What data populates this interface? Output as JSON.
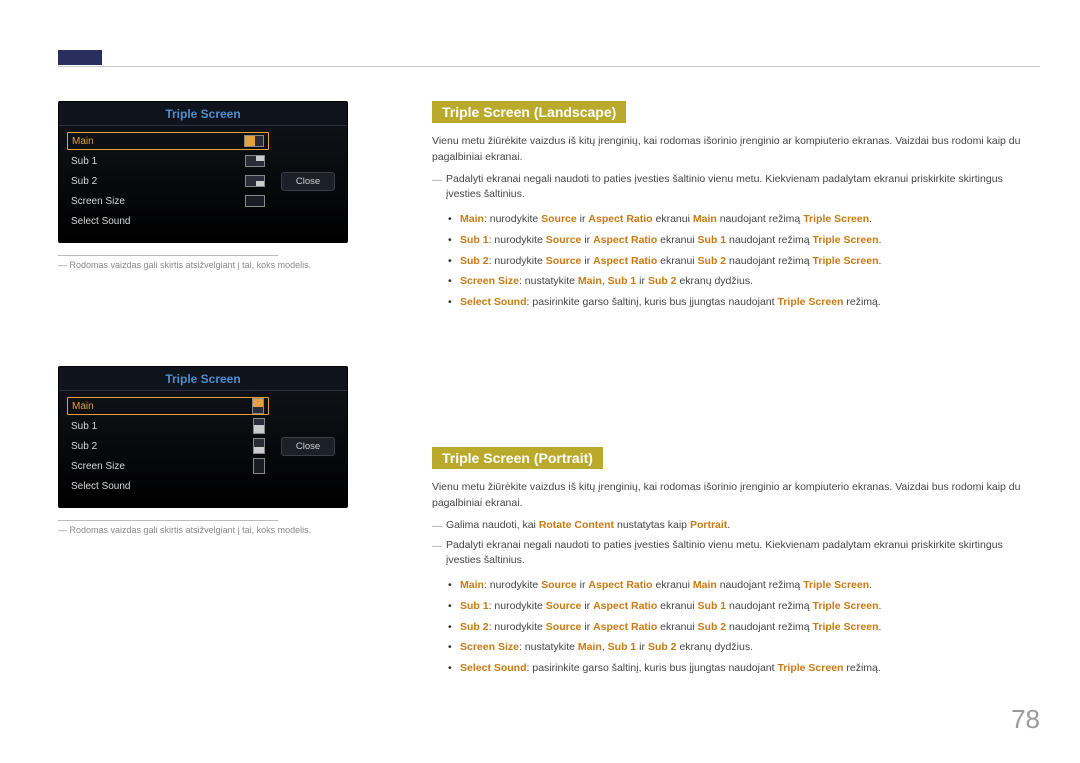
{
  "pageNumber": "78",
  "panels": {
    "landscape": {
      "title": "Triple Screen",
      "rows": [
        {
          "label": "Main",
          "selected": true
        },
        {
          "label": "Sub 1",
          "selected": false
        },
        {
          "label": "Sub 2",
          "selected": false
        },
        {
          "label": "Screen Size",
          "selected": false
        },
        {
          "label": "Select Sound",
          "selected": false
        }
      ],
      "close": "Close",
      "footnote": "Rodomas vaizdas gali skirtis atsižvelgiant į tai, koks modelis."
    },
    "portrait": {
      "title": "Triple Screen",
      "rows": [
        {
          "label": "Main",
          "selected": true
        },
        {
          "label": "Sub 1",
          "selected": false
        },
        {
          "label": "Sub 2",
          "selected": false
        },
        {
          "label": "Screen Size",
          "selected": false
        },
        {
          "label": "Select Sound",
          "selected": false
        }
      ],
      "close": "Close",
      "footnote": "Rodomas vaizdas gali skirtis atsižvelgiant į tai, koks modelis."
    }
  },
  "landscape": {
    "heading": "Triple Screen (Landscape)",
    "intro": "Vienu metu žiūrėkite vaizdus iš kitų įrenginių, kai rodomas išorinio įrenginio ar kompiuterio ekranas. Vaizdai bus rodomi kaip du pagalbiniai ekranai.",
    "note1": "Padalyti ekranai negali naudoti to paties įvesties šaltinio vienu metu. Kiekvienam padalytam ekranui priskirkite skirtingus įvesties šaltinius.",
    "b": {
      "main": {
        "k": "Main",
        "t1": ": nurodykite ",
        "s": "Source",
        "t2": " ir ",
        "a": "Aspect Ratio",
        "t3": " ekranui ",
        "m": "Main",
        "t4": " naudojant režimą ",
        "ts": "Triple Screen",
        "t5": "."
      },
      "sub1": {
        "k": "Sub 1",
        "t1": ": nurodykite ",
        "s": "Source",
        "t2": " ir ",
        "a": "Aspect Ratio",
        "t3": " ekranui ",
        "m": "Sub 1",
        "t4": " naudojant režimą ",
        "ts": "Triple Screen",
        "t5": "."
      },
      "sub2": {
        "k": "Sub 2",
        "t1": ": nurodykite ",
        "s": "Source",
        "t2": " ir ",
        "a": "Aspect Ratio",
        "t3": " ekranui ",
        "m": "Sub 2",
        "t4": " naudojant režimą ",
        "ts": "Triple Screen",
        "t5": "."
      },
      "size": {
        "k": "Screen Size",
        "t1": ": nustatykite ",
        "m": "Main",
        "c": ", ",
        "s1": "Sub 1",
        "t2": " ir ",
        "s2": "Sub 2",
        "t3": " ekranų dydžius."
      },
      "sound": {
        "k": "Select Sound",
        "t1": ": pasirinkite garso šaltinį, kuris bus įjungtas naudojant ",
        "ts": "Triple Screen",
        "t2": " režimą."
      }
    }
  },
  "portrait": {
    "heading": "Triple Screen (Portrait)",
    "intro": "Vienu metu žiūrėkite vaizdus iš kitų įrenginių, kai rodomas išorinio įrenginio ar kompiuterio ekranas. Vaizdai bus rodomi kaip du pagalbiniai ekranai.",
    "noteA_pre": "Galima naudoti, kai ",
    "noteA_rc": "Rotate Content",
    "noteA_mid": " nustatytas kaip ",
    "noteA_p": "Portrait",
    "noteA_end": ".",
    "note1": "Padalyti ekranai negali naudoti to paties įvesties šaltinio vienu metu. Kiekvienam padalytam ekranui priskirkite skirtingus įvesties šaltinius.",
    "b": {
      "main": {
        "k": "Main",
        "t1": ": nurodykite ",
        "s": "Source",
        "t2": " ir ",
        "a": "Aspect Ratio",
        "t3": " ekranui ",
        "m": "Main",
        "t4": " naudojant režimą ",
        "ts": "Triple Screen",
        "t5": "."
      },
      "sub1": {
        "k": "Sub 1",
        "t1": ": nurodykite ",
        "s": "Source",
        "t2": " ir ",
        "a": "Aspect Ratio",
        "t3": " ekranui ",
        "m": "Sub 1",
        "t4": " naudojant režimą ",
        "ts": "Triple Screen",
        "t5": "."
      },
      "sub2": {
        "k": "Sub 2",
        "t1": ": nurodykite ",
        "s": "Source",
        "t2": " ir ",
        "a": "Aspect Ratio",
        "t3": " ekranui ",
        "m": "Sub 2",
        "t4": " naudojant režimą ",
        "ts": "Triple Screen",
        "t5": "."
      },
      "size": {
        "k": "Screen Size",
        "t1": ": nustatykite ",
        "m": "Main",
        "c": ", ",
        "s1": "Sub 1",
        "t2": " ir ",
        "s2": "Sub 2",
        "t3": " ekranų dydžius."
      },
      "sound": {
        "k": "Select Sound",
        "t1": ": pasirinkite garso šaltinį, kuris bus įjungtas naudojant ",
        "ts": "Triple Screen",
        "t2": " režimą."
      }
    }
  }
}
